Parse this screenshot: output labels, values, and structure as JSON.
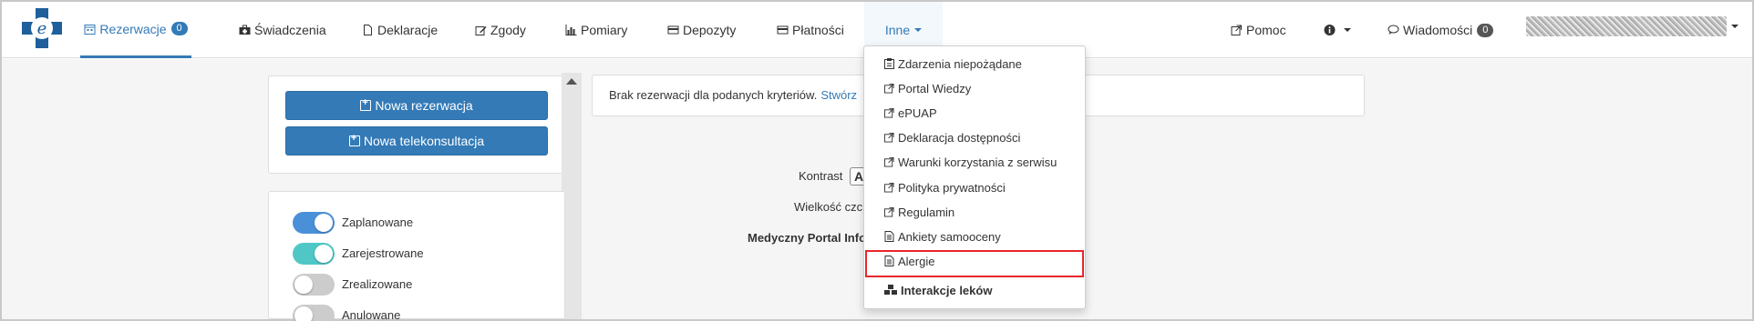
{
  "nav": {
    "items": [
      {
        "label": "Rezerwacje",
        "badge": "0",
        "icon": "calendar-icon"
      },
      {
        "label": "Świadczenia",
        "icon": "medkit-icon"
      },
      {
        "label": "Deklaracje",
        "icon": "file-icon"
      },
      {
        "label": "Zgody",
        "icon": "edit-icon"
      },
      {
        "label": "Pomiary",
        "icon": "bar-chart-icon"
      },
      {
        "label": "Depozyty",
        "icon": "card-icon"
      },
      {
        "label": "Płatności",
        "icon": "credit-card-icon"
      },
      {
        "label": "Inne",
        "icon": "caret-down-icon"
      }
    ],
    "help": {
      "label": "Pomoc",
      "icon": "external-link-icon"
    },
    "info_icon": "info-circle-icon",
    "messages": {
      "label": "Wiadomości",
      "badge": "0",
      "icon": "comments-icon"
    },
    "accent_color": "#337ab7"
  },
  "sidebar": {
    "new_reservation": "Nowa rezerwacja",
    "new_teleconsultation": "Nowa telekonsultacja"
  },
  "filters": [
    {
      "label": "Zaplanowane",
      "on": true,
      "color": "#4a90d9"
    },
    {
      "label": "Zarejestrowane",
      "on": true,
      "color": "#4fc7c7"
    },
    {
      "label": "Zrealizowane",
      "on": false,
      "color": "#cccccc"
    },
    {
      "label": "Anulowane",
      "on": false,
      "color": "#cccccc"
    }
  ],
  "alert": {
    "text": "Brak rezerwacji dla podanych kryteriów.",
    "link": "Stwórz"
  },
  "footer": {
    "contrast": "Kontrast",
    "font_size": "Wielkość czci",
    "portal": "Medyczny Portal Info"
  },
  "dropdown": {
    "items": [
      {
        "label": "Zdarzenia niepożądane",
        "icon": "clipboard-icon"
      },
      {
        "label": "Portal Wiedzy",
        "icon": "external-link-icon"
      },
      {
        "label": "ePUAP",
        "icon": "external-link-icon"
      },
      {
        "label": "Deklaracja dostępności",
        "icon": "external-link-icon"
      },
      {
        "label": "Warunki korzystania z serwisu",
        "icon": "external-link-icon"
      },
      {
        "label": "Polityka prywatności",
        "icon": "external-link-icon"
      },
      {
        "label": "Regulamin",
        "icon": "external-link-icon"
      },
      {
        "label": "Ankiety samooceny",
        "icon": "document-icon"
      },
      {
        "label": "Alergie",
        "icon": "document-icon"
      },
      {
        "label": "Interakcje leków",
        "icon": "cubes-icon"
      }
    ],
    "highlight_color": "#e8262b"
  }
}
